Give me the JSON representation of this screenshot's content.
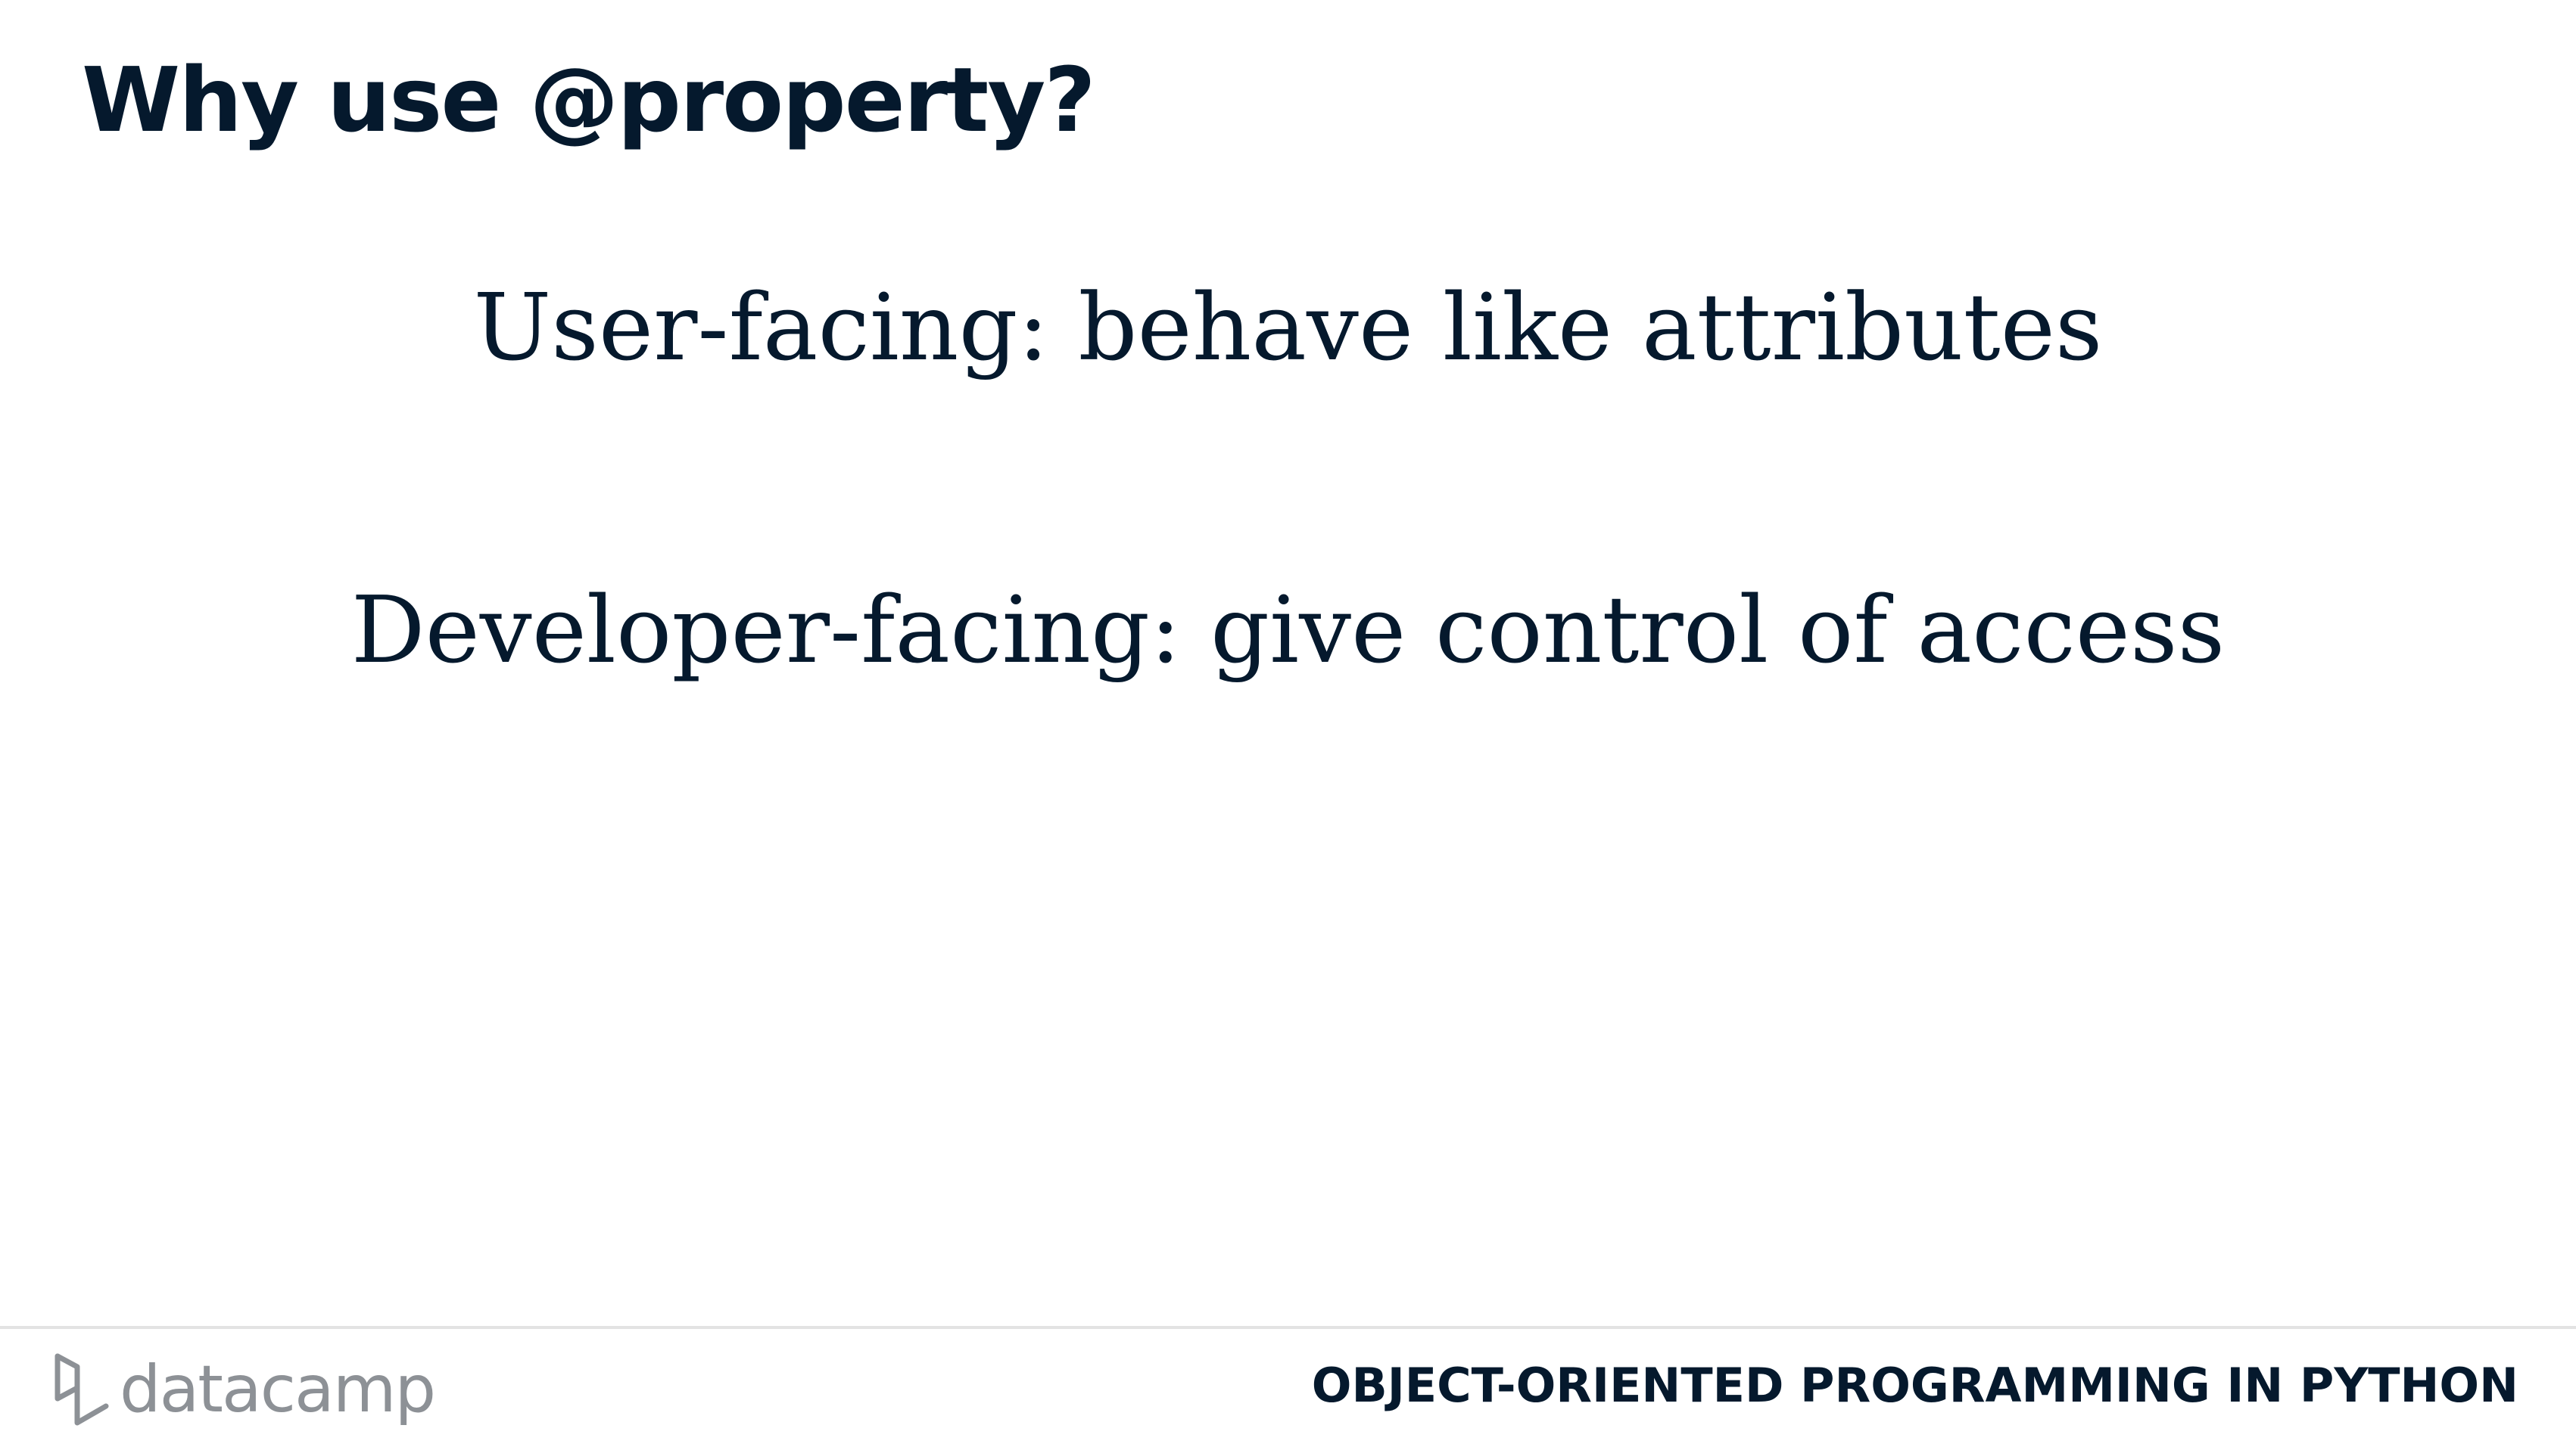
{
  "slide": {
    "title": "Why use @property?",
    "statements": [
      "User-facing: behave like attributes",
      "Developer-facing: give control of access"
    ]
  },
  "footer": {
    "logo_text": "datacamp",
    "logo_icon": "datacamp-logo-icon",
    "course_name": "OBJECT-ORIENTED PROGRAMMING IN PYTHON"
  },
  "colors": {
    "text": "#05192d",
    "logo_gray": "#8d9196",
    "rule": "#e3e3e3",
    "background": "#ffffff"
  }
}
